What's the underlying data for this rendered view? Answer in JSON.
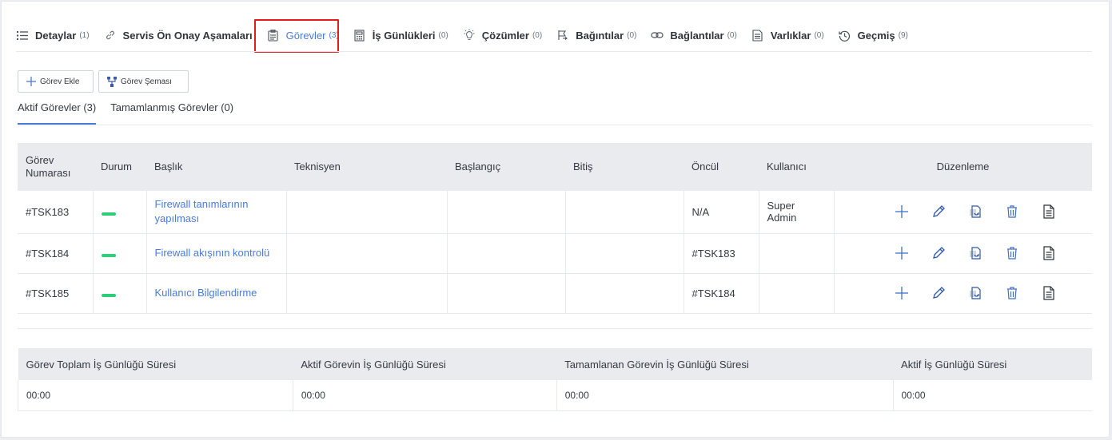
{
  "tabs": [
    {
      "label": "Detaylar",
      "count": "(1)",
      "icon": "list-icon"
    },
    {
      "label": "Servis Ön Onay Aşamaları",
      "count": "",
      "icon": "link-icon"
    },
    {
      "label": "Görevler",
      "count": "(3)",
      "icon": "clipboard-icon"
    },
    {
      "label": "İş Günlükleri",
      "count": "(0)",
      "icon": "calculator-icon"
    },
    {
      "label": "Çözümler",
      "count": "(0)",
      "icon": "lightbulb-icon"
    },
    {
      "label": "Bağıntılar",
      "count": "(0)",
      "icon": "flag-icon"
    },
    {
      "label": "Bağlantılar",
      "count": "(0)",
      "icon": "chain-icon"
    },
    {
      "label": "Varlıklar",
      "count": "(0)",
      "icon": "document-list-icon"
    },
    {
      "label": "Geçmiş",
      "count": "(9)",
      "icon": "history-icon"
    }
  ],
  "buttons": {
    "add_task": "Görev Ekle",
    "task_schema": "Görev Şeması"
  },
  "subtabs": {
    "active": "Aktif Görevler (3)",
    "completed": "Tamamlanmış Görevler (0)"
  },
  "tasks": {
    "headers": {
      "number": "Görev Numarası",
      "status": "Durum",
      "title": "Başlık",
      "technician": "Teknisyen",
      "start": "Başlangıç",
      "end": "Bitiş",
      "predecessor": "Öncül",
      "user": "Kullanıcı",
      "edit": "Düzenleme"
    },
    "rows": [
      {
        "number": "#TSK183",
        "title": "Firewall tanımlarının yapılması",
        "technician": "",
        "start": "",
        "end": "",
        "predecessor": "N/A",
        "user": "Super Admin"
      },
      {
        "number": "#TSK184",
        "title": "Firewall akışının kontrolü",
        "technician": "",
        "start": "",
        "end": "",
        "predecessor": "#TSK183",
        "user": ""
      },
      {
        "number": "#TSK185",
        "title": "Kullanıcı Bilgilendirme",
        "technician": "",
        "start": "",
        "end": "",
        "predecessor": "#TSK184",
        "user": ""
      }
    ]
  },
  "summary": {
    "headers": [
      "Görev Toplam İş Günlüğü Süresi",
      "Aktif Görevin İş Günlüğü Süresi",
      "Tamamlanan Görevin İş Günlüğü Süresi",
      "Aktif İş Günlüğü Süresi"
    ],
    "values": [
      "00:00",
      "00:00",
      "00:00",
      "00:00"
    ]
  },
  "colors": {
    "accent": "#4a7bdc",
    "status_active": "#2dce78",
    "highlight": "#e11d1d"
  }
}
